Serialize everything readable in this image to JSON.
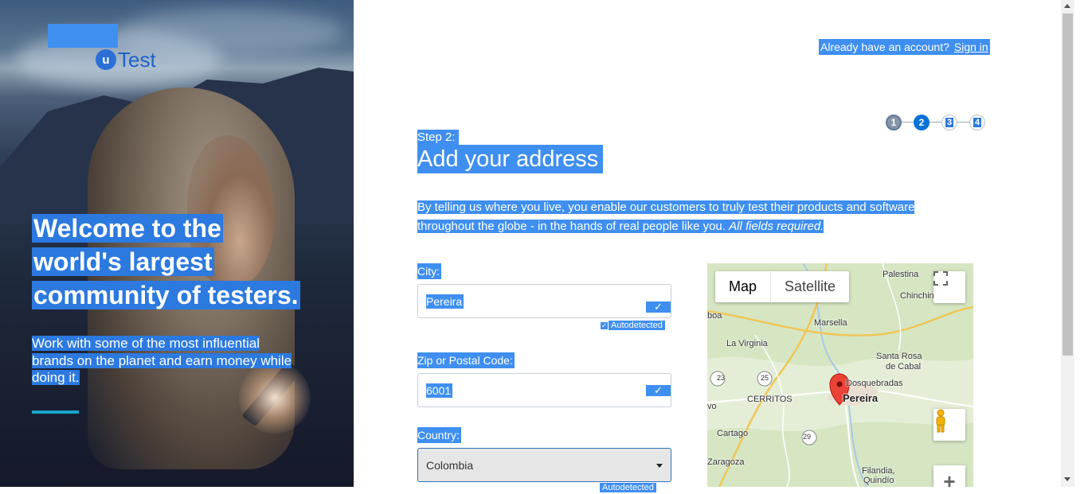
{
  "hero": {
    "logo_mark": "u",
    "logo_text": "Test",
    "title_lines": [
      "Welcome to the",
      "world's largest",
      "community of testers."
    ],
    "subtitle_lines": [
      "Work with some of the most influential",
      "brands on the planet and earn money while",
      "doing it."
    ]
  },
  "header": {
    "account_prompt": "Already have an account?",
    "signin_label": "Sign in"
  },
  "steps": {
    "items": [
      "1",
      "2",
      "3",
      "4"
    ],
    "current": 2
  },
  "form": {
    "step_label": "Step 2:",
    "title": "Add your address",
    "intro_lines": [
      "By telling us where you live, you enable our customers to truly test their products and software",
      "throughout the globe - in the hands of real people like you. "
    ],
    "intro_emphasis": "All fields required.",
    "city": {
      "label": "City:",
      "value": "Pereira",
      "status": "Autodetected",
      "check": "✓"
    },
    "zip": {
      "label": "Zip or Postal Code:",
      "value": "6001",
      "check": "✓"
    },
    "country": {
      "label": "Country:",
      "value": "Colombia",
      "status": "Autodetected"
    }
  },
  "map": {
    "type_map": "Map",
    "type_satellite": "Satellite",
    "labels": [
      "Palestina",
      "Chinchiná",
      "Marsella",
      "La Virginia",
      "Santa Rosa",
      "de Cabal",
      "Dosquebradas",
      "Pereira",
      "CERRITOS",
      "Cartago",
      "Zaragoza",
      "Filandia,",
      "Quindío",
      "boa",
      "vo"
    ],
    "route_numbers": [
      "23",
      "25",
      "29"
    ],
    "zoom_in": "+"
  },
  "colors": {
    "selection": "#3f8ff0",
    "step_current": "#0a73d9",
    "accent_rule": "#18a4c8"
  }
}
